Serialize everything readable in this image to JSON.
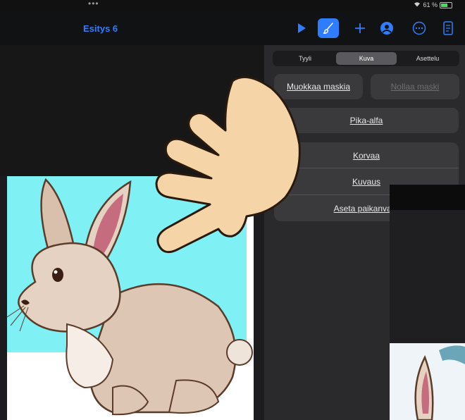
{
  "status": {
    "wifi_battery": "61 %"
  },
  "toolbar": {
    "title": "Esitys 6"
  },
  "panel": {
    "tabs": [
      "Tyyli",
      "Kuva",
      "Asettelu"
    ],
    "edit_mask": "Muokkaa maskia",
    "reset_mask": "Nollaa maski",
    "instant_alpha": "Pika-alfa",
    "replace": "Korvaa",
    "description": "Kuvaus",
    "set_placeholder": "Aseta paikanvara"
  },
  "colors": {
    "accent": "#2f7dff",
    "slide_background": "#7ff0f4"
  },
  "icons": [
    "play-icon",
    "paintbrush-icon",
    "plus-icon",
    "collaborate-icon",
    "more-icon",
    "document-icon",
    "wifi-icon",
    "battery-icon"
  ]
}
